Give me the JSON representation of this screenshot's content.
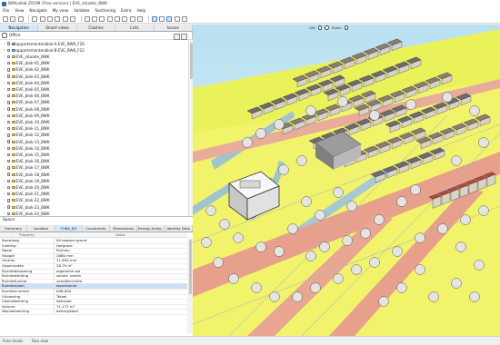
{
  "window": {
    "title": "BIMcollab ZOOM (Free version) | EVE_situatie_BWK"
  },
  "menu": [
    "File",
    "View",
    "Navigate",
    "My view",
    "Validate",
    "Sectioning",
    "Extra",
    "Help"
  ],
  "nav_tabs": [
    {
      "label": "Navigation",
      "active": true
    },
    {
      "label": "Smart views",
      "active": false
    },
    {
      "label": "Clashes",
      "active": false
    },
    {
      "label": "Lists",
      "active": false
    },
    {
      "label": "Issues",
      "active": false
    }
  ],
  "tree": {
    "root": "Office",
    "items": [
      {
        "label": "appartementenblok-A-EVE_BWK_F20",
        "depth": 1,
        "checked": true
      },
      {
        "label": "appartementenblok-B-EVE_BWK_F22",
        "depth": 1,
        "checked": true
      },
      {
        "label": "EVE_situatie_BWK",
        "depth": 1,
        "checked": true
      },
      {
        "label": "EVE_blok-01_BWK",
        "depth": 1,
        "checked": true
      },
      {
        "label": "EVE_blok-02_BWK",
        "depth": 1,
        "checked": true
      },
      {
        "label": "EVE_blok-03_BWK",
        "depth": 1,
        "checked": true
      },
      {
        "label": "EVE_blok-04_BWK",
        "depth": 1,
        "checked": true
      },
      {
        "label": "EVE_blok-05_BWK",
        "depth": 1,
        "checked": true
      },
      {
        "label": "EVE_blok-06_BWK",
        "depth": 1,
        "checked": true
      },
      {
        "label": "EVE_blok-07_BWK",
        "depth": 1,
        "checked": true
      },
      {
        "label": "EVE_blok-08_BWK",
        "depth": 1,
        "checked": true
      },
      {
        "label": "EVE_blok-09_BWK",
        "depth": 1,
        "checked": true
      },
      {
        "label": "EVE_blok-10_BWK",
        "depth": 1,
        "checked": true
      },
      {
        "label": "EVE_blok-11_BWK",
        "depth": 1,
        "checked": true
      },
      {
        "label": "EVE_blok-12_BWK",
        "depth": 1,
        "checked": true
      },
      {
        "label": "EVE_blok-13_BWK",
        "depth": 1,
        "checked": true
      },
      {
        "label": "EVE_blok-14_BWK",
        "depth": 1,
        "checked": true
      },
      {
        "label": "EVE_blok-15_BWK",
        "depth": 1,
        "checked": true
      },
      {
        "label": "EVE_blok-16_BWK",
        "depth": 1,
        "checked": true
      },
      {
        "label": "EVE_blok-17_BWK",
        "depth": 1,
        "checked": true
      },
      {
        "label": "EVE_blok-18_BWK",
        "depth": 1,
        "checked": true
      },
      {
        "label": "EVE_blok-19_BWK",
        "depth": 1,
        "checked": true
      },
      {
        "label": "EVE_blok-20_BWK",
        "depth": 1,
        "checked": true
      },
      {
        "label": "EVE_blok-21_BWK",
        "depth": 1,
        "checked": true
      },
      {
        "label": "EVE_blok-22_BWK",
        "depth": 1,
        "checked": true
      },
      {
        "label": "EVE_blok-23_BWK",
        "depth": 1,
        "checked": true
      },
      {
        "label": "EVE_blok-24_BWK",
        "depth": 1,
        "checked": true
      }
    ]
  },
  "space_panel": {
    "title": "Space",
    "tabs": [
      {
        "label": "Summary",
        "active": false
      },
      {
        "label": "Location",
        "active": false
      },
      {
        "label": "TOBA_B3",
        "active": true
      },
      {
        "label": "Constraints",
        "active": false
      },
      {
        "label": "Dimensions",
        "active": false
      },
      {
        "label": "Energy Analy...",
        "active": false
      },
      {
        "label": "Identity Data",
        "active": false
      }
    ],
    "columns": [
      "Property",
      "Value"
    ],
    "rows": [
      {
        "k": "Bouwlaag",
        "v": "00 begane grond",
        "sel": false
      },
      {
        "k": "Indeling",
        "v": "Hofgrave",
        "sel": false
      },
      {
        "k": "Naam",
        "v": "Ruimen",
        "sel": false
      },
      {
        "k": "Hoogte",
        "v": "2680 mm",
        "sel": false
      },
      {
        "k": "Omtrek",
        "v": "21.850 mm",
        "sel": false
      },
      {
        "k": "Oppervlakte",
        "v": "28.79 m²",
        "sel": false
      },
      {
        "k": "Ruimtebenaming",
        "v": "algemene wo",
        "sel": false
      },
      {
        "k": "Ruimtewerking",
        "v": "zonder ramen",
        "sel": false
      },
      {
        "k": "Ruimtefunctie",
        "v": "verblijfsruimte",
        "sel": false
      },
      {
        "k": "Ruimtenaam",
        "v": "woonkamer",
        "sel": true
      },
      {
        "k": "Ruimtenummer",
        "v": "00B.004",
        "sel": false
      },
      {
        "k": "Uitvoering",
        "v": "Totaal",
        "sel": false
      },
      {
        "k": "Vloerafwerking",
        "v": "dekvloer",
        "sel": false
      },
      {
        "k": "Volume",
        "v": "71.172 m³",
        "sel": false
      },
      {
        "k": "Wandafwerking",
        "v": "behangklaar",
        "sel": false
      }
    ]
  },
  "viewport_toolbar": [
    "GW",
    "Zoom"
  ],
  "status": [
    "Free mode",
    "Run now"
  ]
}
